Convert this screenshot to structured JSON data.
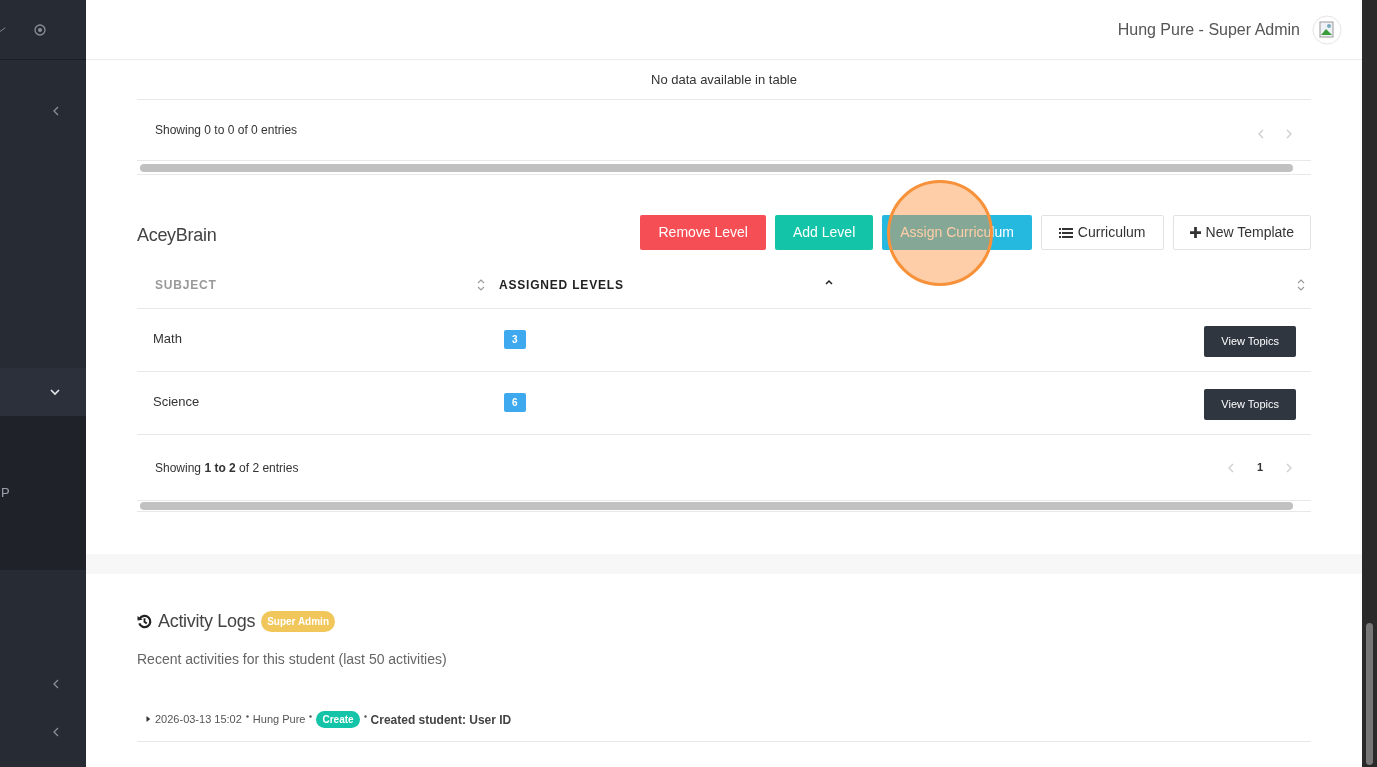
{
  "sidebar": {
    "items": [
      {
        "expanded": false
      },
      {
        "expanded": true,
        "children": [
          {
            "label": "P"
          }
        ]
      },
      {
        "expanded": false
      },
      {
        "expanded": false
      }
    ]
  },
  "header": {
    "user": "Hung Pure - Super Admin"
  },
  "table_1": {
    "empty_message": "No data available in table",
    "info": "Showing 0 to 0 of 0 entries"
  },
  "curriculum": {
    "title": "AceyBrain",
    "buttons": [
      {
        "label": "Remove Level",
        "kind": "danger"
      },
      {
        "label": "Add Level",
        "kind": "success"
      },
      {
        "label": "Assign Curriculum",
        "kind": "info"
      },
      {
        "label": "Curriculum",
        "kind": "list"
      },
      {
        "label": "New Template",
        "kind": "add"
      }
    ],
    "columns": [
      {
        "label": "SUBJECT",
        "sorted": false
      },
      {
        "label": "ASSIGNED LEVELS",
        "sorted": true
      },
      {
        "sorted": false
      }
    ],
    "rows": [
      {
        "subject": "Math",
        "levels": "3",
        "action": "View Topics"
      },
      {
        "subject": "Science",
        "levels": "6",
        "action": "View Topics"
      }
    ],
    "info": "Showing **1 to 2** of 2 entries",
    "pages": [
      {
        "label": "1",
        "selected": true
      }
    ]
  },
  "activity_logs": {
    "title": "Activity Logs",
    "badge": "Super Admin",
    "subtitle": "Recent activities for this student (last 50 activities)",
    "entries": [
      {
        "expanded": false,
        "time": "2026-03-13 15:02",
        "user": "Hung Pure",
        "action": "Create",
        "description": "Created student: User ID"
      }
    ]
  }
}
